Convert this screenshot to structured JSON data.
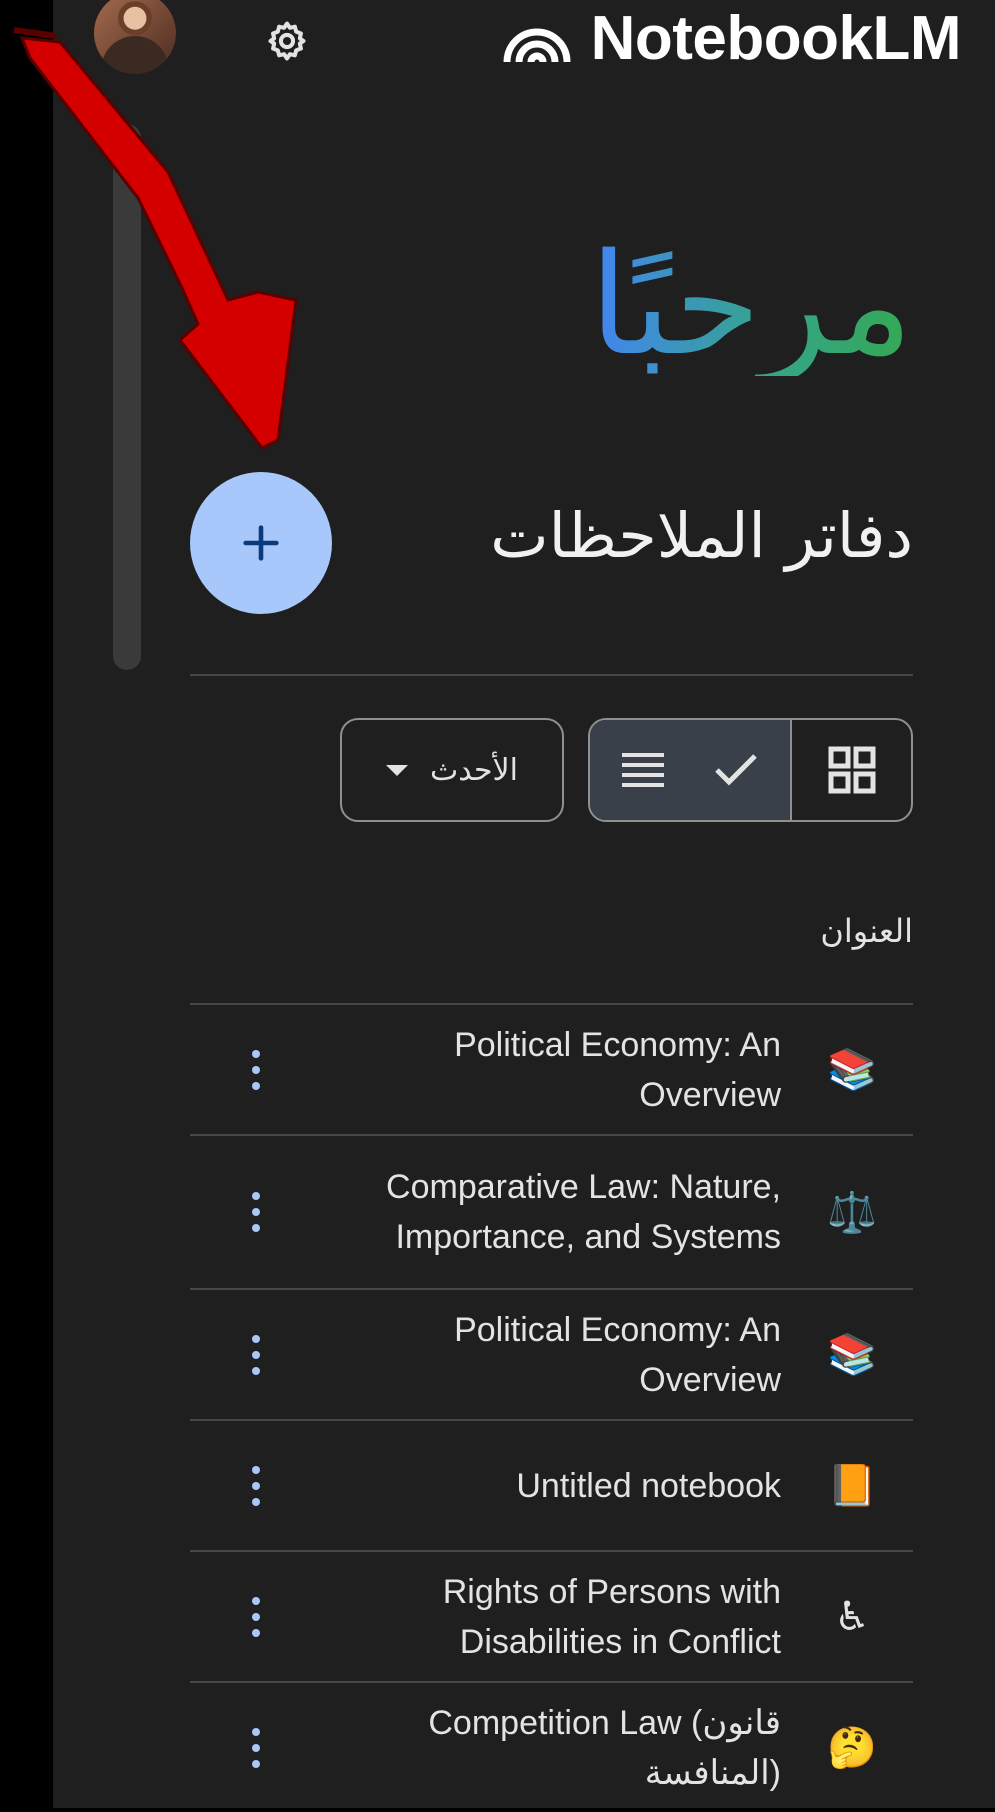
{
  "header": {
    "brand_name": "NotebookLM"
  },
  "welcome": {
    "title": "مرحبًا"
  },
  "notebooks": {
    "section_title": "دفاتر الملاحظات",
    "sort_label": "الأحدث",
    "column_title": "العنوان",
    "items": [
      {
        "title": "Political Economy: An Overview",
        "emoji": "📚"
      },
      {
        "title": "Comparative Law: Nature, Importance, and Systems",
        "emoji": "⚖️"
      },
      {
        "title": "Political Economy: An Overview",
        "emoji": "📚"
      },
      {
        "title": "Untitled notebook",
        "emoji": "📙"
      },
      {
        "title": "Rights of Persons with Disabilities in Conflict",
        "emoji": "♿"
      },
      {
        "title": "Competition Law (قانون المنافسة)",
        "emoji": "🤔"
      }
    ]
  },
  "colors": {
    "background": "#1f1f1f",
    "fab": "#a8c7fa",
    "accent_blue": "#a8c7fa",
    "annotation_arrow": "#d40000"
  }
}
